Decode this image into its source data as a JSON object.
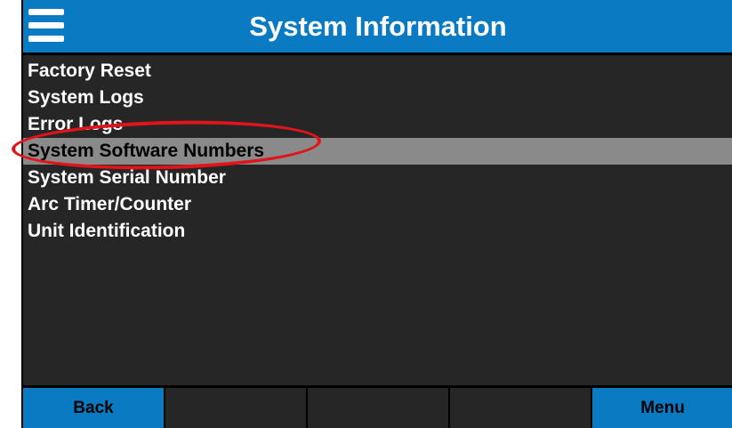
{
  "header": {
    "title": "System Information",
    "menu_icon": "hamburger-menu-icon"
  },
  "menu": {
    "items": [
      {
        "label": "Factory Reset"
      },
      {
        "label": "System Logs"
      },
      {
        "label": "Error Logs"
      },
      {
        "label": "System Software Numbers"
      },
      {
        "label": "System Serial Number"
      },
      {
        "label": "Arc Timer/Counter"
      },
      {
        "label": "Unit Identification"
      }
    ],
    "selected_index": 3
  },
  "footer": {
    "back_label": "Back",
    "menu_label": "Menu"
  },
  "colors": {
    "accent_blue": "#0a7ac2",
    "background": "#262626",
    "selected_row": "#8a8a8a",
    "annotation_red": "#e1141b"
  }
}
